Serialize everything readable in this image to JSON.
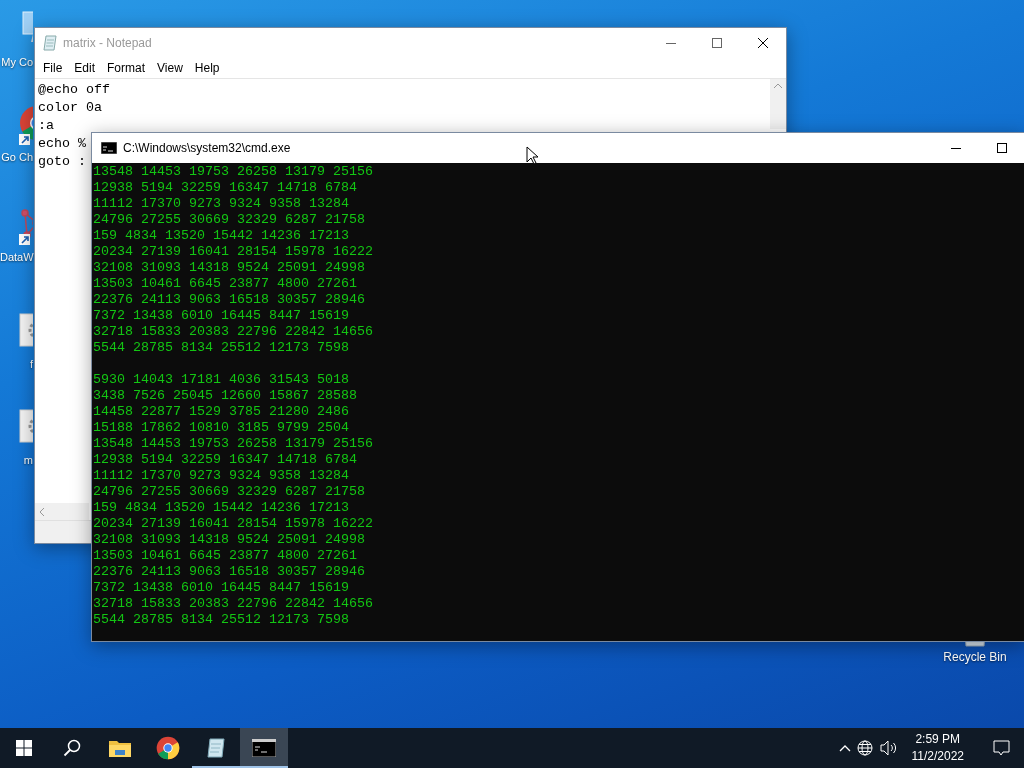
{
  "desktop_icons": [
    {
      "kind": "computer",
      "label": "My Co",
      "shortcut": false
    },
    {
      "kind": "chrome",
      "label": "Go Ch",
      "shortcut": true
    },
    {
      "kind": "graph",
      "label": "DataW",
      "shortcut": true
    },
    {
      "kind": "file",
      "label": "f",
      "shortcut": false
    },
    {
      "kind": "file",
      "label": "m",
      "shortcut": false
    }
  ],
  "recycle_bin": {
    "label": "Recycle Bin"
  },
  "notepad": {
    "title": "matrix - Notepad",
    "menu": [
      "File",
      "Edit",
      "Format",
      "View",
      "Help"
    ],
    "lines": [
      "@echo off",
      "color 0a",
      ":a",
      "echo %",
      "goto :"
    ]
  },
  "cmd": {
    "title": "C:\\Windows\\system32\\cmd.exe",
    "blocks": [
      [
        "13548 14453 19753 26258 13179 25156",
        "12938 5194 32259 16347 14718 6784",
        "11112 17370 9273 9324 9358 13284",
        "24796 27255 30669 32329 6287 21758",
        "159 4834 13520 15442 14236 17213",
        "20234 27139 16041 28154 15978 16222",
        "32108 31093 14318 9524 25091 24998",
        "13503 10461 6645 23877 4800 27261",
        "22376 24113 9063 16518 30357 28946",
        "7372 13438 6010 16445 8447 15619",
        "32718 15833 20383 22796 22842 14656",
        "5544 28785 8134 25512 12173 7598"
      ],
      [
        "5930 14043 17181 4036 31543 5018",
        "3438 7526 25045 12660 15867 28588",
        "14458 22877 1529 3785 21280 2486",
        "15188 17862 10810 3185 9799 2504",
        "13548 14453 19753 26258 13179 25156",
        "12938 5194 32259 16347 14718 6784",
        "11112 17370 9273 9324 9358 13284",
        "24796 27255 30669 32329 6287 21758",
        "159 4834 13520 15442 14236 17213",
        "20234 27139 16041 28154 15978 16222",
        "32108 31093 14318 9524 25091 24998",
        "13503 10461 6645 23877 4800 27261",
        "22376 24113 9063 16518 30357 28946",
        "7372 13438 6010 16445 8447 15619",
        "32718 15833 20383 22796 22842 14656",
        "5544 28785 8134 25512 12173 7598"
      ]
    ]
  },
  "taskbar": {
    "apps": [
      {
        "kind": "start",
        "open": false,
        "selected": false
      },
      {
        "kind": "search",
        "open": false,
        "selected": false
      },
      {
        "kind": "folder",
        "open": false,
        "selected": false
      },
      {
        "kind": "chrome",
        "open": false,
        "selected": false
      },
      {
        "kind": "notepad",
        "open": true,
        "selected": false
      },
      {
        "kind": "terminal",
        "open": true,
        "selected": true
      }
    ],
    "time": "2:59 PM",
    "date": "11/2/2022"
  }
}
